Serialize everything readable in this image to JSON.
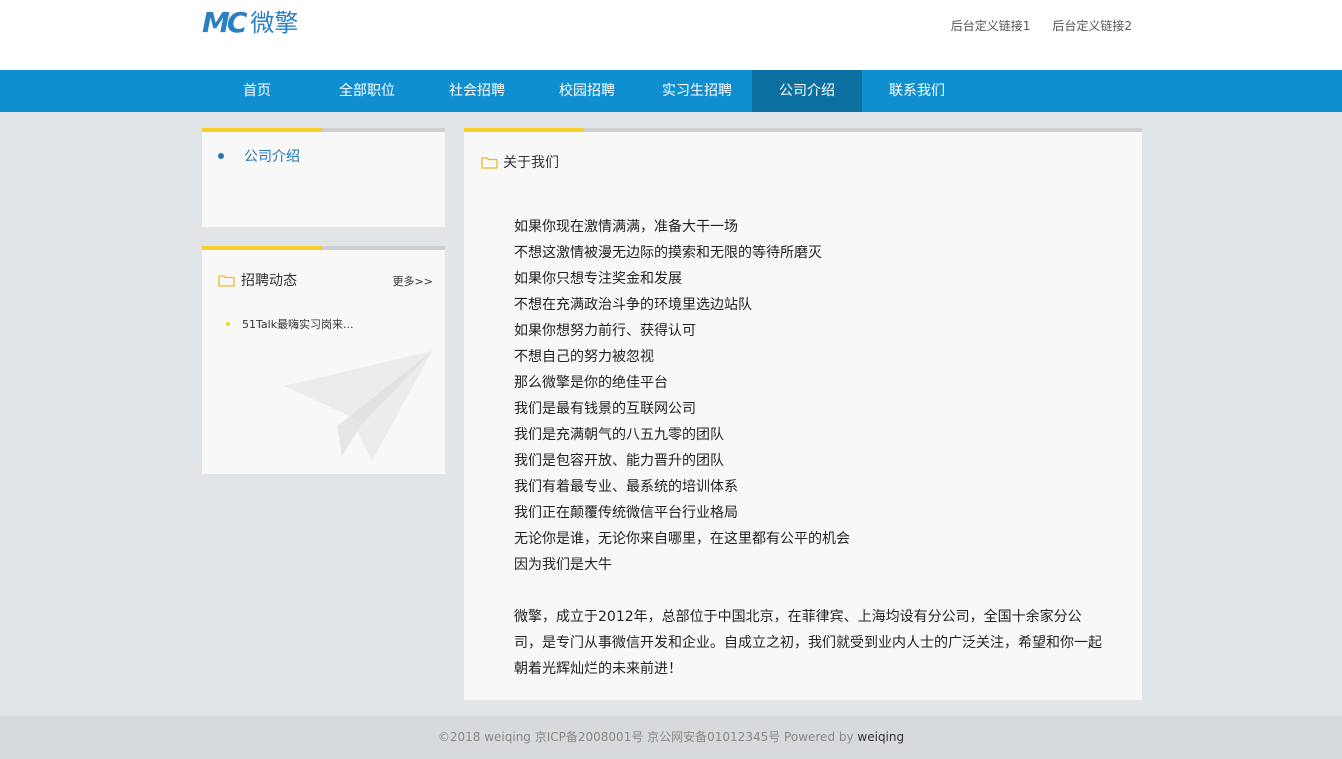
{
  "header": {
    "logo_mark": "MC",
    "logo_text": "微擎",
    "links": [
      "后台定义链接1",
      "后台定义链接2"
    ]
  },
  "nav": {
    "items": [
      {
        "label": "首页",
        "width": 110
      },
      {
        "label": "全部职位",
        "width": 110
      },
      {
        "label": "社会招聘",
        "width": 110
      },
      {
        "label": "校园招聘",
        "width": 110
      },
      {
        "label": "实习生招聘",
        "width": 110
      },
      {
        "label": "公司介绍",
        "width": 110
      },
      {
        "label": "联系我们",
        "width": 110
      }
    ],
    "active_index": 5
  },
  "sidebar": {
    "menu_item": "公司介绍",
    "news": {
      "title": "招聘动态",
      "more": "更多>>",
      "items": [
        "51Talk最嗨实习岗来..."
      ]
    }
  },
  "main": {
    "title": "关于我们",
    "lines": [
      "如果你现在激情满满，准备大干一场",
      "不想这激情被漫无边际的摸索和无限的等待所磨灭",
      "如果你只想专注奖金和发展",
      "不想在充满政治斗争的环境里选边站队",
      "如果你想努力前行、获得认可",
      "不想自己的努力被忽视",
      "那么微擎是你的绝佳平台",
      "我们是最有钱景的互联网公司",
      "我们是充满朝气的八五九零的团队",
      "我们是包容开放、能力晋升的团队",
      "我们有着最专业、最系统的培训体系",
      "我们正在颠覆传统微信平台行业格局",
      "无论你是谁，无论你来自哪里，在这里都有公平的机会",
      "因为我们是大牛"
    ],
    "paragraph": "微擎，成立于2012年，总部位于中国北京，在菲律宾、上海均设有分公司，全国十余家分公司，是专门从事微信开发和企业。自成立之初，我们就受到业内人士的广泛关注，希望和你一起朝着光辉灿烂的未来前进！"
  },
  "footer": {
    "text": "©2018  weiqing  京ICP备2008001号 京公网安备01012345号  Powered by ",
    "brand": "weiqing"
  },
  "colors": {
    "nav_bg": "#0f8fd0",
    "nav_active": "#0b6f9f",
    "accent_yellow": "#f6cf2b",
    "link_blue": "#2677b2"
  }
}
